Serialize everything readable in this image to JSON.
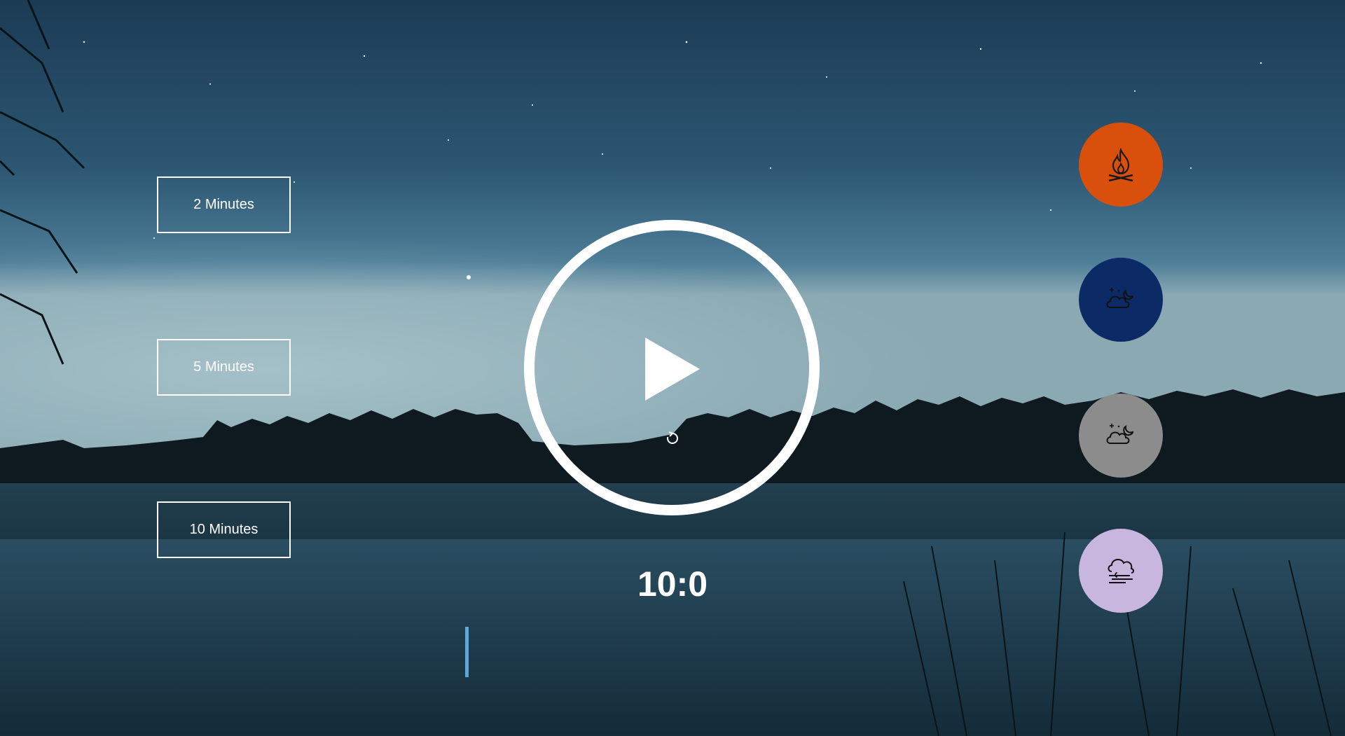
{
  "durations": [
    {
      "label": "2 Minutes"
    },
    {
      "label": "5 Minutes"
    },
    {
      "label": "10 Minutes"
    }
  ],
  "timer": {
    "display": "10:0"
  },
  "sounds": [
    {
      "icon": "campfire-icon",
      "color": "#d9500c"
    },
    {
      "icon": "night-cloud-icon",
      "color": "#0b2a66"
    },
    {
      "icon": "night-cloud-icon",
      "color": "#8c8c8c"
    },
    {
      "icon": "wind-cloud-icon",
      "color": "#c9b6de"
    }
  ],
  "colors": {
    "sky_top": "#1d3a52",
    "sky_mid": "#3b6784",
    "horizon": "#8fb0c0",
    "water": "#1a3443"
  }
}
